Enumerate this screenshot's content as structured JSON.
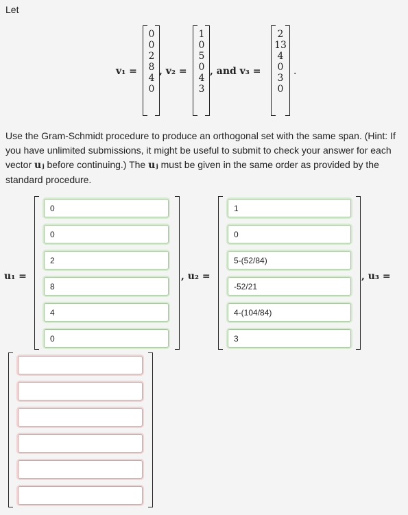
{
  "intro": "Let",
  "given": {
    "v1": {
      "label": "v₁ =",
      "values": [
        "0",
        "0",
        "2",
        "8",
        "4",
        "0"
      ]
    },
    "v2": {
      "label": ", v₂ =",
      "values": [
        "1",
        "0",
        "5",
        "0",
        "4",
        "3"
      ]
    },
    "v3": {
      "label": ", and v₃ =",
      "values": [
        "2",
        "13",
        "4",
        "0",
        "3",
        "0"
      ]
    },
    "end": "."
  },
  "instructions": {
    "part1": "Use the Gram-Schmidt procedure to produce an orthogonal set with the same span. (Hint: If you have unlimited submissions, it might be useful to submit to check your answer for each vector ",
    "uj1": "uⱼ",
    "part2": " before continuing.) The ",
    "uj2": "uⱼ",
    "part3": " must be given in the same order as provided by the standard procedure."
  },
  "answers": {
    "u1": {
      "label": "u₁ =",
      "values": [
        "0",
        "0",
        "2",
        "8",
        "4",
        "0"
      ]
    },
    "u2": {
      "label": ", u₂ =",
      "values": [
        "1",
        "0",
        "5-(52/84)",
        "-52/21",
        "4-(104/84)",
        "3"
      ]
    },
    "u3": {
      "label": ", u₃ =",
      "values": [
        "",
        "",
        "",
        "",
        "",
        ""
      ]
    }
  }
}
